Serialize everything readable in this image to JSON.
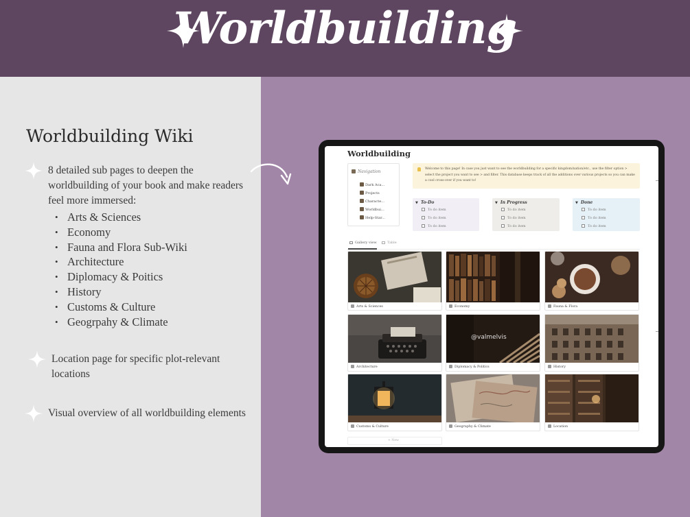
{
  "header": {
    "title": "Worldbuilding",
    "sparkle_color": "#ffffff",
    "background": "#5e4660"
  },
  "left_panel": {
    "heading": "Worldbuilding Wiki",
    "features": [
      {
        "text": "8 detailed sub pages to deepen the worldbuilding of your book and make readers feel more immersed:",
        "bullets": [
          "Arts & Sciences",
          "Economy",
          "Fauna and Flora Sub-Wiki",
          "Architecture",
          "Diplomacy & Poitics",
          "History",
          "Customs & Culture",
          "Geogrpahy & Climate"
        ]
      },
      {
        "text": "Location page for specific plot-relevant locations"
      },
      {
        "text": "Visual overview of all worldbuilding elements"
      }
    ]
  },
  "app": {
    "page_title": "Worldbuilding",
    "navigation": {
      "title": "Navigation",
      "items": [
        "Dark Aca...",
        "Projects",
        "Characte...",
        "Worldbui...",
        "Help-Star..."
      ]
    },
    "callout": {
      "icon": "lightbulb-icon",
      "text": "Welcome to this page! In case you just want to see the worldbuilding for a specific kingdom/nation/etc., use the filter option > select the project you want to see > and filter. This database keeps track of all the additions over various projects so you can make a cool cross-over if you want to!"
    },
    "boards": [
      {
        "title": "To-Do",
        "items": [
          "To do item",
          "To do item",
          "To do item"
        ],
        "color": "#f1eff5"
      },
      {
        "title": "In Progress",
        "items": [
          "To do item",
          "To do item",
          "To do item"
        ],
        "color": "#eeede9"
      },
      {
        "title": "Done",
        "items": [
          "To do item",
          "To do item",
          "To do item"
        ],
        "color": "#e6f1f7"
      }
    ],
    "views": [
      "Gallery view",
      "Table"
    ],
    "gallery": [
      {
        "caption": "Arts & Sciences"
      },
      {
        "caption": "Economy"
      },
      {
        "caption": "Fauna & Flora"
      },
      {
        "caption": "Architecture"
      },
      {
        "caption": "Diplomacy & Politics"
      },
      {
        "caption": "History"
      },
      {
        "caption": "Customs & Culture"
      },
      {
        "caption": "Geography & Climate"
      },
      {
        "caption": "Location"
      }
    ],
    "watermark": "@valmelvis",
    "new_label": "+ New"
  }
}
